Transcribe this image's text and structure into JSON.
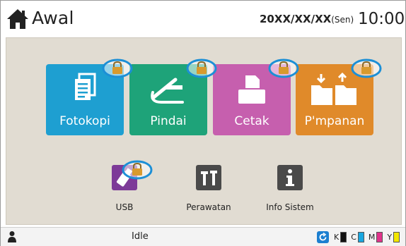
{
  "header": {
    "title": "Awal",
    "date": "20XX/XX/XX",
    "day": "(Sen)",
    "time": "10:00"
  },
  "main_tiles": [
    {
      "label": "Fotokopi",
      "color": "#1e9fd1"
    },
    {
      "label": "Pindai",
      "color": "#1ea379"
    },
    {
      "label": "Cetak",
      "color": "#c65fae"
    },
    {
      "label": "P'mpanan",
      "color": "#e08a2a"
    }
  ],
  "small_tiles": [
    {
      "label": "USB",
      "color": "#7d3a98"
    },
    {
      "label": "Perawatan",
      "color": "#4a4a4a"
    },
    {
      "label": "Info Sistem",
      "color": "#4a4a4a"
    }
  ],
  "status": {
    "state": "Idle",
    "inks": [
      {
        "label": "K",
        "color": "#111111"
      },
      {
        "label": "C",
        "color": "#19a7e0"
      },
      {
        "label": "M",
        "color": "#e0338b"
      },
      {
        "label": "Y",
        "color": "#f2e600"
      }
    ]
  },
  "colors": {
    "panel": "#e1dcd2",
    "lock_ring": "#1c8fd6",
    "lock_body": "#d89a2e"
  }
}
